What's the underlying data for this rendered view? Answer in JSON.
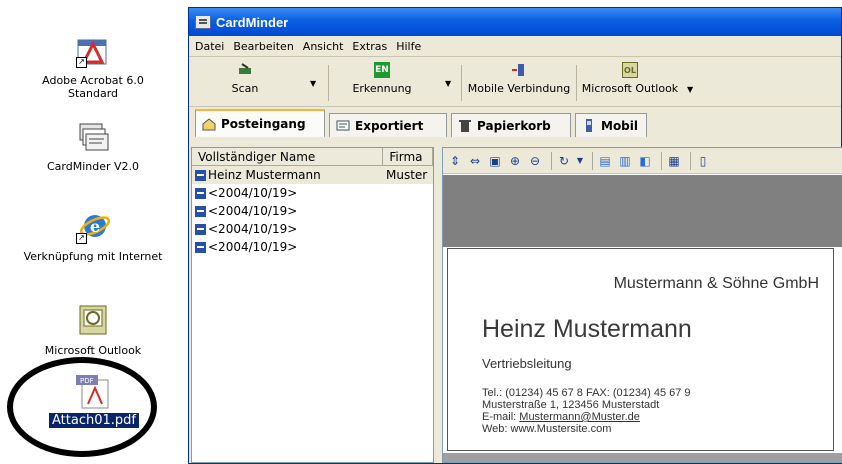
{
  "desktop": {
    "icons": [
      {
        "label": "Adobe Acrobat 6.0 Standard",
        "line1": "Adobe Acrobat 6.0",
        "line2": "Standard"
      },
      {
        "label": "CardMinder V2.0"
      },
      {
        "label": "Verknüpfung mit Internet"
      },
      {
        "label": "Microsoft Outlook"
      },
      {
        "label": "Attach01.pdf",
        "badge": "PDF"
      }
    ]
  },
  "window": {
    "title": "CardMinder",
    "menu": [
      "Datei",
      "Bearbeiten",
      "Ansicht",
      "Extras",
      "Hilfe"
    ],
    "toolbar": {
      "scan": "Scan",
      "erkennung": "Erkennung",
      "erkennung_badge": "EN",
      "mobile": "Mobile Verbindung",
      "outlook": "Microsoft Outlook",
      "outlook_badge": "OL"
    },
    "tabs": [
      "Posteingang",
      "Exportiert",
      "Papierkorb",
      "Mobil"
    ],
    "list": {
      "headers": [
        "Vollständiger Name",
        "Firma"
      ],
      "rows": [
        {
          "name": "Heinz Mustermann",
          "firma": "Muster"
        },
        {
          "name": "<2004/10/19>",
          "firma": ""
        },
        {
          "name": "<2004/10/19>",
          "firma": ""
        },
        {
          "name": "<2004/10/19>",
          "firma": ""
        },
        {
          "name": "<2004/10/19>",
          "firma": ""
        }
      ]
    },
    "card": {
      "company": "Mustermann & Söhne GmbH",
      "name": "Heinz Mustermann",
      "role": "Vertriebsleitung",
      "tel": "Tel.: (01234) 45 67 8  FAX: (01234) 45 67 9",
      "address": "Musterstraße 1, 123456 Musterstadt",
      "email_prefix": "E-mail: ",
      "email": "Mustermann@Muster.de",
      "web": "Web: www.Mustersite.com"
    }
  },
  "colors": {
    "titlebar": "#0a5fe0",
    "selection": "#0a246a",
    "chrome": "#ece9d8"
  }
}
